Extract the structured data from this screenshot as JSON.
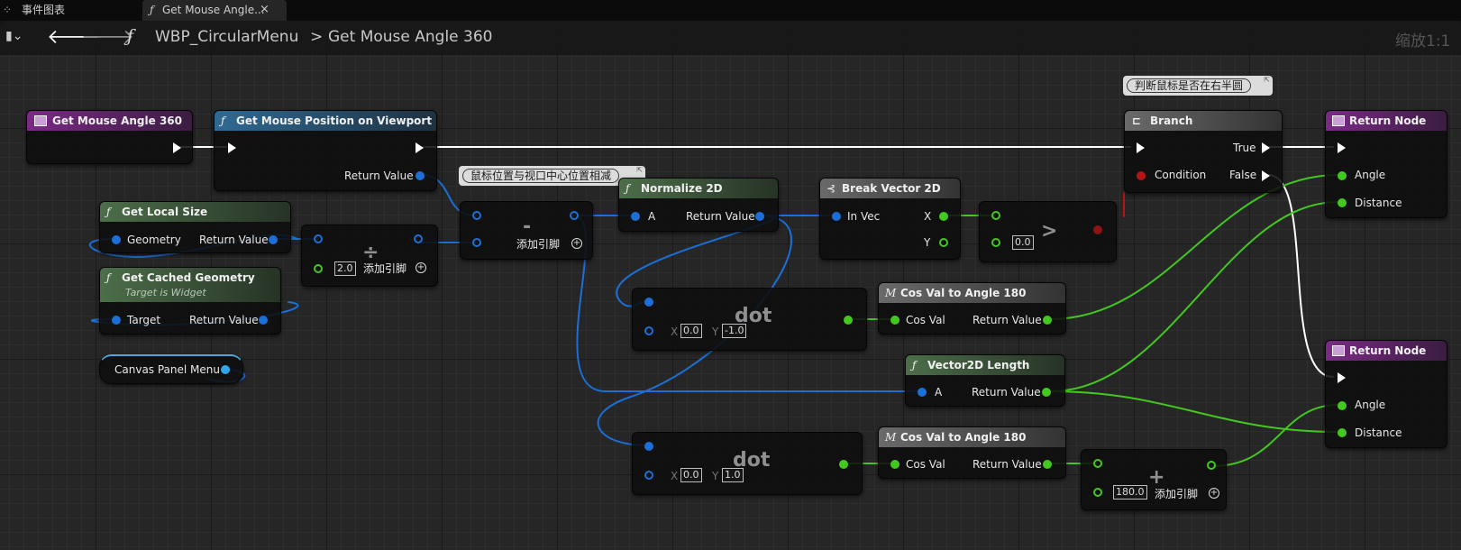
{
  "tabs": [
    {
      "label": "事件图表",
      "icon": "event-graph-icon"
    },
    {
      "label": "Get Mouse Angle...",
      "icon": "function-icon",
      "close_glyph": "×"
    }
  ],
  "toolbar": {
    "breadcrumb_root": "WBP_CircularMenu",
    "separator": ">",
    "breadcrumb_current": "Get Mouse Angle 360",
    "zoom": "缩放1:1"
  },
  "common": {
    "return_value": "Return Value",
    "add_pin": "添加引脚"
  },
  "nodes": {
    "entry": {
      "title": "Get Mouse Angle 360"
    },
    "mouse_pos": {
      "title": "Get Mouse Position on Viewport"
    },
    "local_size": {
      "title": "Get Local Size",
      "geometry": "Geometry"
    },
    "cached_geo": {
      "title": "Get Cached Geometry",
      "subtitle": "Target is Widget",
      "target": "Target"
    },
    "canvas": {
      "title": "Canvas Panel Menu"
    },
    "divide": {
      "op": "÷",
      "value": "2.0"
    },
    "subtract": {
      "op": "-",
      "comment": "鼠标位置与视口中心位置相减"
    },
    "normalize": {
      "title": "Normalize 2D",
      "a": "A"
    },
    "break_vec": {
      "title": "Break Vector 2D",
      "in_vec": "In Vec",
      "x": "X",
      "y": "Y"
    },
    "greater": {
      "op": ">",
      "value": "0.0"
    },
    "branch": {
      "title": "Branch",
      "comment": "判断鼠标是否在右半圆",
      "condition": "Condition",
      "true": "True",
      "false": "False"
    },
    "return1": {
      "title": "Return Node",
      "angle": "Angle",
      "distance": "Distance"
    },
    "return2": {
      "title": "Return Node",
      "angle": "Angle",
      "distance": "Distance"
    },
    "dot1": {
      "op": "dot",
      "x_label": "X",
      "x_value": "0.0",
      "y_label": "Y",
      "y_value": "-1.0"
    },
    "dot2": {
      "op": "dot",
      "x_label": "X",
      "x_value": "0.0",
      "y_label": "Y",
      "y_value": "1.0"
    },
    "cos1": {
      "title": "Cos Val to Angle 180",
      "cos_val": "Cos Val"
    },
    "cos2": {
      "title": "Cos Val to Angle 180",
      "cos_val": "Cos Val"
    },
    "vlen": {
      "title": "Vector2D Length",
      "a": "A"
    },
    "add": {
      "op": "+",
      "value": "180.0"
    }
  },
  "colors": {
    "exec": "#ffffff",
    "vector": "#1b6fd6",
    "float": "#43c81f",
    "bool": "#b51515",
    "object": "#2fa7e6"
  }
}
